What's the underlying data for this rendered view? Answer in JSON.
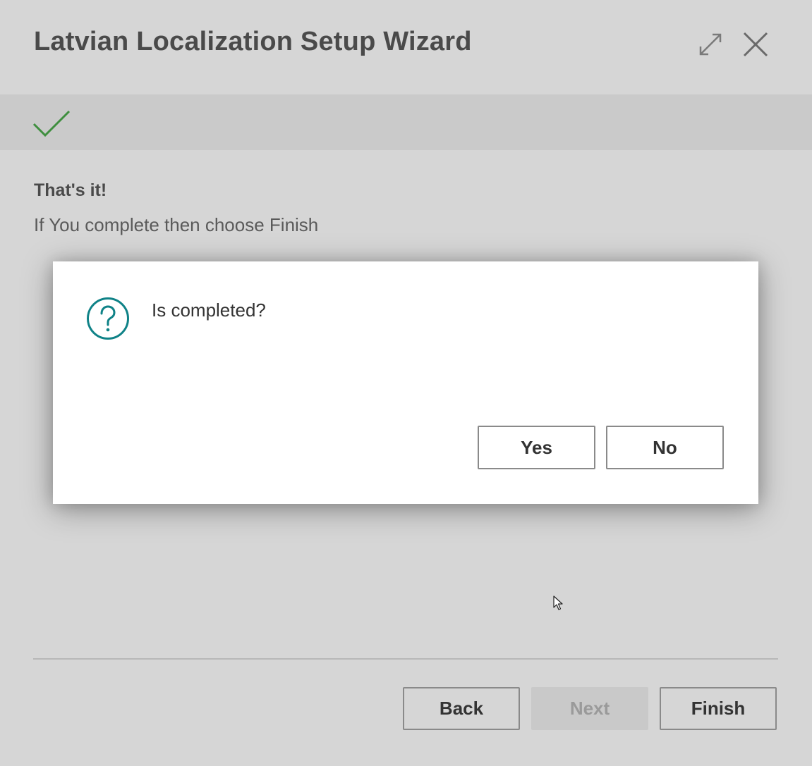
{
  "window": {
    "title": "Latvian Localization Setup Wizard",
    "expand_icon": "expand-icon",
    "close_icon": "close-icon"
  },
  "banner": {
    "icon": "checkmark-icon",
    "icon_color": "#3f8f3f"
  },
  "content": {
    "heading": "That's it!",
    "instructions": "If You complete then choose Finish"
  },
  "dialog": {
    "icon": "question-icon",
    "icon_color": "#0f8287",
    "message": "Is completed?",
    "yes_label": "Yes",
    "no_label": "No"
  },
  "footer": {
    "back_label": "Back",
    "next_label": "Next",
    "finish_label": "Finish"
  }
}
